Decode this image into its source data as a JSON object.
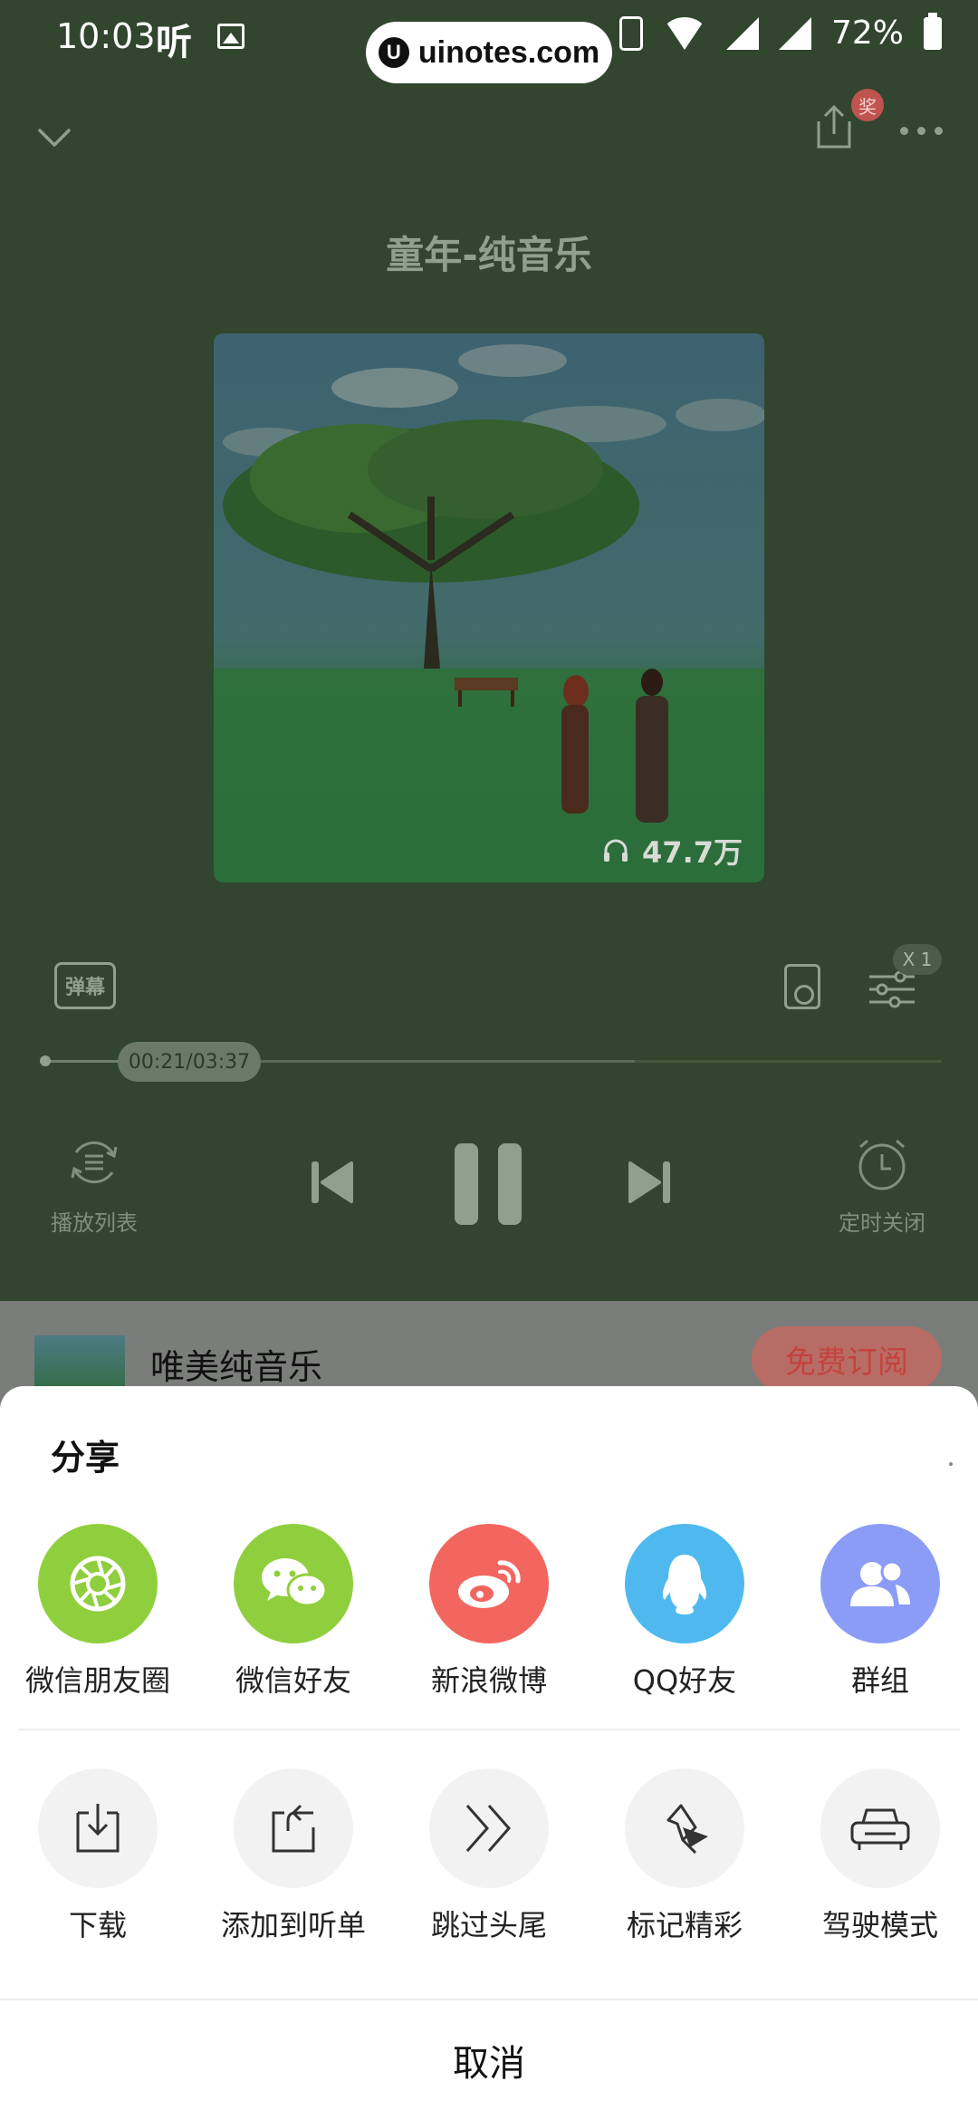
{
  "status_bar": {
    "time": "10:03",
    "app_glyph": "听",
    "battery": "72%"
  },
  "watermark": {
    "text": "uinotes.com",
    "logo": "U"
  },
  "player": {
    "title": "童年-纯音乐",
    "award_badge": "奖",
    "play_count": "47.7万",
    "danmu_label": "弹幕",
    "speed": "X 1",
    "time_display": "00:21/03:37",
    "progress_fraction": 0.097,
    "buffer_fraction": 0.66,
    "playlist_label": "播放列表",
    "timer_label": "定时关闭"
  },
  "mini_bar": {
    "album_title": "唯美纯音乐",
    "subscribe_label": "免费订阅"
  },
  "share_sheet": {
    "title": "分享",
    "share_targets": [
      {
        "label": "微信朋友圈",
        "icon": "moments-icon",
        "color": "#8fcf3d"
      },
      {
        "label": "微信好友",
        "icon": "wechat-icon",
        "color": "#8fcf3d"
      },
      {
        "label": "新浪微博",
        "icon": "weibo-icon",
        "color": "#f2665f"
      },
      {
        "label": "QQ好友",
        "icon": "qq-icon",
        "color": "#4fb9ef"
      },
      {
        "label": "群组",
        "icon": "group-icon",
        "color": "#8b9cf7"
      }
    ],
    "actions": [
      {
        "label": "下载",
        "icon": "download-icon"
      },
      {
        "label": "添加到听单",
        "icon": "add-to-list-icon"
      },
      {
        "label": "跳过头尾",
        "icon": "skip-intro-outro-icon"
      },
      {
        "label": "标记精彩",
        "icon": "pin-icon"
      },
      {
        "label": "驾驶模式",
        "icon": "car-icon"
      }
    ],
    "cancel_label": "取消"
  }
}
